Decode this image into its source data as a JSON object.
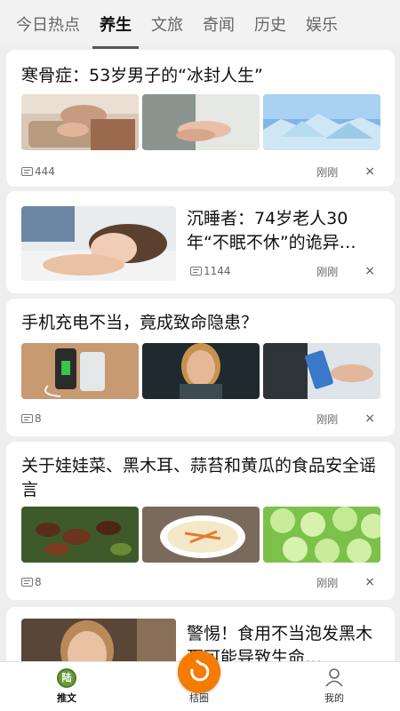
{
  "tabs": [
    {
      "label": "今日热点"
    },
    {
      "label": "养生"
    },
    {
      "label": "文旅"
    },
    {
      "label": "奇闻"
    },
    {
      "label": "历史"
    },
    {
      "label": "娱乐"
    }
  ],
  "active_tab": "养生",
  "articles": [
    {
      "title": "寒骨症：53岁男子的“冰封人生”",
      "comments": "444",
      "time": "刚刚"
    },
    {
      "title": "沉睡者：74岁老人30年“不眠不休”的诡异…",
      "comments": "1144",
      "time": "刚刚"
    },
    {
      "title": "手机充电不当，竟成致命隐患？",
      "comments": "8",
      "time": "刚刚"
    },
    {
      "title": "关于娃娃菜、黑木耳、蒜苔和黄瓜的食品安全谣言",
      "comments": "8",
      "time": "刚刚"
    },
    {
      "title": "警惕！食用不当泡发黑木耳可能导致生命…"
    }
  ],
  "close_symbol": "×",
  "nav": {
    "left_label": "推文",
    "left_icon_text": "陆",
    "center_label": "桔圈",
    "right_label": "我的"
  },
  "colors": {
    "accent": "#f57c00",
    "nav_green": "#4c7a2c"
  }
}
